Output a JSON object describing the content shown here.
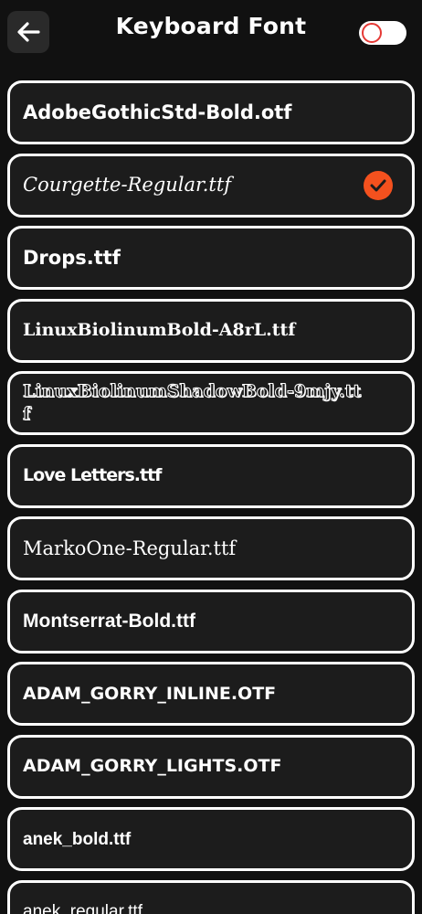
{
  "header": {
    "title": "Keyboard Font",
    "back_icon": "arrow-left-icon",
    "toggle_on": false
  },
  "colors": {
    "background": "#111111",
    "item_border": "#ffffff",
    "check_accent": "#f4511e",
    "toggle_knob_border": "#e53935"
  },
  "fonts": [
    {
      "label": "AdobeGothicStd-Bold.otf",
      "selected": false
    },
    {
      "label": "Courgette-Regular.ttf",
      "selected": true
    },
    {
      "label": "Drops.ttf",
      "selected": false
    },
    {
      "label": "LinuxBiolinumBold-A8rL.ttf",
      "selected": false
    },
    {
      "label": "LinuxBiolinumShadowBold-9mjy.ttf",
      "selected": false
    },
    {
      "label": "Love Letters.ttf",
      "selected": false
    },
    {
      "label": "MarkoOne-Regular.ttf",
      "selected": false
    },
    {
      "label": "Montserrat-Bold.ttf",
      "selected": false
    },
    {
      "label": "ADAM_GORRY_INLINE.OTF",
      "selected": false
    },
    {
      "label": "ADAM_GORRY_LIGHTS.OTF",
      "selected": false
    },
    {
      "label": "anek_bold.ttf",
      "selected": false
    },
    {
      "label": "anek_regular.ttf",
      "selected": false
    }
  ]
}
